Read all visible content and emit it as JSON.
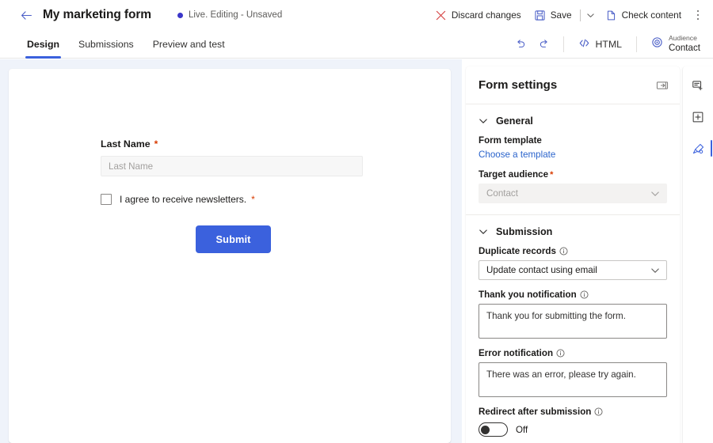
{
  "header": {
    "back_icon": "arrow-left-icon",
    "title": "My marketing form",
    "status": "Live. Editing - Unsaved",
    "status_dot_color": "#3b36c9",
    "commands": {
      "discard_label": "Discard changes",
      "discard_icon": "close-x-icon",
      "save_label": "Save",
      "save_icon": "save-disk-icon",
      "save_chevron_icon": "chevron-down-icon",
      "check_content_label": "Check content",
      "check_content_icon": "document-check-icon",
      "overflow_icon": "more-vertical-icon"
    }
  },
  "tabbar": {
    "tabs": [
      {
        "label": "Design",
        "active": true
      },
      {
        "label": "Submissions",
        "active": false
      },
      {
        "label": "Preview and test",
        "active": false
      }
    ],
    "undo_icon": "undo-arrow-icon",
    "redo_icon": "redo-arrow-icon",
    "html_label": "HTML",
    "html_icon": "code-brackets-icon",
    "audience_icon": "target-audience-icon",
    "audience_caption": "Audience",
    "audience_value": "Contact"
  },
  "form_canvas": {
    "fields": [
      {
        "type": "text",
        "label": "Last Name",
        "required_marker": "*",
        "placeholder": "Last Name",
        "value": ""
      },
      {
        "type": "checkbox",
        "label": "I agree to receive newsletters.",
        "required_marker": "*",
        "checked": false
      }
    ],
    "submit_label": "Submit",
    "submit_color": "#3b61dd",
    "required_color": "#d83b01"
  },
  "settings": {
    "title": "Form settings",
    "collapse_icon": "collapse-panel-icon",
    "sections": [
      {
        "title": "General",
        "chevron_icon": "chevron-down-icon",
        "form_template_label": "Form template",
        "choose_template_link": "Choose a template",
        "target_audience_label": "Target audience",
        "target_audience_required": "*",
        "target_audience_value": "Contact",
        "target_audience_chevron": "chevron-down-icon"
      },
      {
        "title": "Submission",
        "chevron_icon": "chevron-down-icon",
        "duplicate_records_label": "Duplicate records",
        "duplicate_records_info": "info-circle-icon",
        "duplicate_records_value": "Update contact using email",
        "duplicate_records_chevron": "chevron-down-icon",
        "thank_you_label": "Thank you notification",
        "thank_you_info": "info-circle-icon",
        "thank_you_value": "Thank you for submitting the form.",
        "error_label": "Error notification",
        "error_info": "info-circle-icon",
        "error_value": "There was an error, please try again.",
        "redirect_label": "Redirect after submission",
        "redirect_info": "info-circle-icon",
        "redirect_state": "Off",
        "redirect_on": false
      }
    ]
  },
  "rail": {
    "items": [
      {
        "icon": "add-field-icon",
        "active": false
      },
      {
        "icon": "add-section-icon",
        "active": false
      },
      {
        "icon": "style-brush-icon",
        "active": true
      }
    ],
    "accent_color": "#3b61dd"
  }
}
